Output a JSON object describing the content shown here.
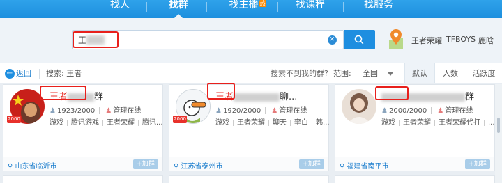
{
  "nav": {
    "tabs": [
      "找人",
      "找群",
      "找主播",
      "找课程",
      "找服务"
    ],
    "active": "找群",
    "hot_badge": "热"
  },
  "search": {
    "value": "王",
    "hotwords": [
      "王者荣耀",
      "TFBOYS",
      "鹿晗"
    ]
  },
  "filter": {
    "back_label": "返回",
    "query_label": "搜索: 王者",
    "not_found": "搜索不到我的群?",
    "range_label": "范围:",
    "range_value": "全国",
    "sort_tabs": [
      "默认",
      "人数",
      "活跃度"
    ]
  },
  "cards": [
    {
      "name_keyword": "王者",
      "name_suffix": "群",
      "members": "1923/2000",
      "manager": "管理在线",
      "tags": [
        "游戏",
        "腾讯游戏",
        "王者荣耀",
        "腾讯..."
      ],
      "level": "2000",
      "location": "山东省临沂市",
      "join_label": "+加群"
    },
    {
      "name_keyword": "王者",
      "name_suffix": "聊...",
      "members": "1920/2000",
      "manager": "管理在线",
      "tags": [
        "游戏",
        "王者荣耀",
        "聊天",
        "李白",
        "韩..."
      ],
      "level": "2000",
      "location": "江苏省泰州市",
      "join_label": "+加群"
    },
    {
      "name_keyword": "",
      "name_suffix": "群",
      "members": "2000/2000",
      "manager": "管理在线",
      "tags": [
        "游戏",
        "王者荣耀",
        "王者荣耀代打",
        "..."
      ],
      "level": "",
      "location": "福建省南平市",
      "join_label": "+加群"
    }
  ],
  "colors": {
    "nav_blue": "#1e8ee0",
    "keyword_red": "#e8312b",
    "link_blue": "#1e7fce"
  }
}
